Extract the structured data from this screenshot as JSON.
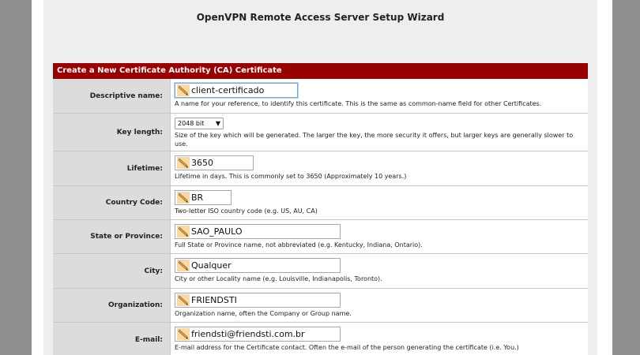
{
  "wizard": {
    "title": "OpenVPN Remote Access Server Setup Wizard"
  },
  "section": {
    "title": "Create a New Certificate Authority (CA) Certificate"
  },
  "fields": {
    "descriptive_name": {
      "label": "Descriptive name:",
      "value": "client-certificado",
      "hint": "A name for your reference, to identify this certificate. This is the same as common-name field for other Certificates."
    },
    "key_length": {
      "label": "Key length:",
      "selected": "2048 bit",
      "arrow": "▼",
      "hint": "Size of the key which will be generated. The larger the key, the more security it offers, but larger keys are generally slower to use."
    },
    "lifetime": {
      "label": "Lifetime:",
      "value": "3650",
      "hint": "Lifetime in days. This is commonly set to 3650 (Approximately 10 years.)"
    },
    "country_code": {
      "label": "Country Code:",
      "value": "BR",
      "hint": "Two-letter ISO country code (e.g. US, AU, CA)"
    },
    "state": {
      "label": "State or Province:",
      "value": "SAO_PAULO",
      "hint": "Full State or Province name, not abbreviated (e.g. Kentucky, Indiana, Ontario)."
    },
    "city": {
      "label": "City:",
      "value": "Qualquer",
      "hint": "City or other Locality name (e.g. Louisville, Indianapolis, Toronto)."
    },
    "organization": {
      "label": "Organization:",
      "value": "FRIENDSTI",
      "hint": "Organization name, often the Company or Group name."
    },
    "email": {
      "label": "E-mail:",
      "value": "friendsti@friendsti.com.br",
      "hint": "E-mail address for the Certificate contact. Often the e-mail of the person generating the certificate (i.e. You.)"
    }
  },
  "icons": {
    "input_prefix": "pencil-icon"
  },
  "colors": {
    "header": "#990000",
    "label_bg": "#dcdcdc",
    "page_bg": "#eeeeee",
    "side": "#8e8e8e"
  }
}
